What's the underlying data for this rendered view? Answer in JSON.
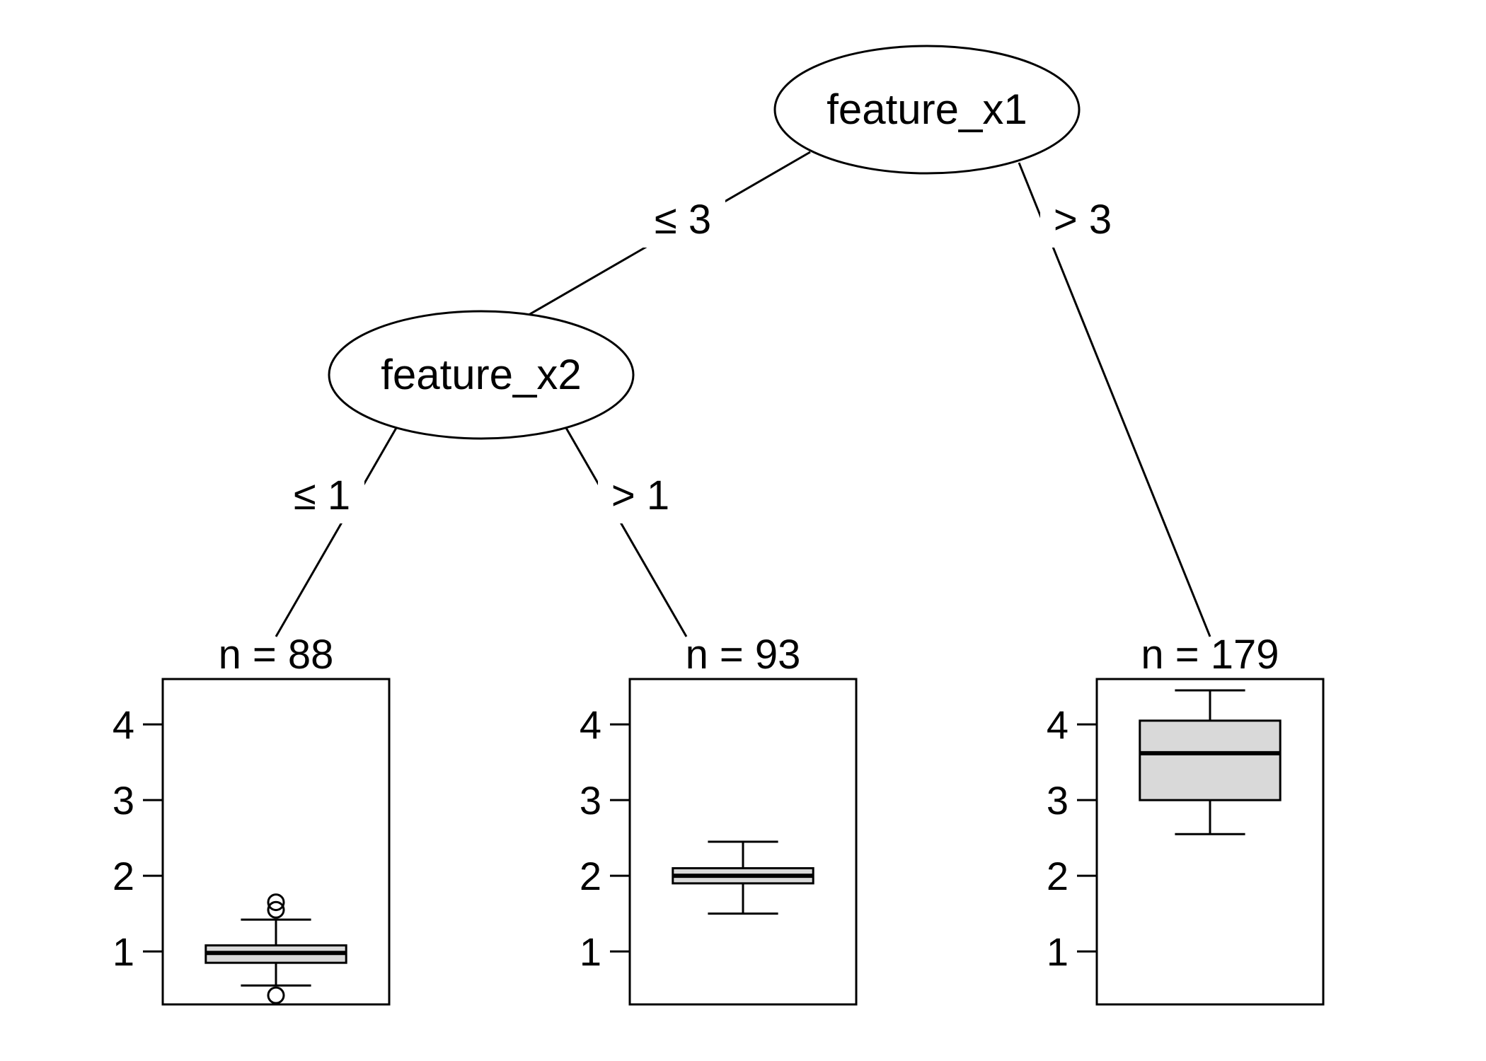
{
  "chart_data": {
    "type": "tree_boxplot",
    "description": "Decision tree with two internal nodes and three terminal boxplot nodes",
    "y_axis_ticks": [
      1,
      2,
      3,
      4
    ],
    "y_range": [
      0.3,
      4.6
    ],
    "nodes": {
      "root": {
        "feature": "feature_x1",
        "split_left": "≤ 3",
        "split_right": "> 3"
      },
      "left_internal": {
        "feature": "feature_x2",
        "split_left": "≤ 1",
        "split_right": "> 1"
      }
    },
    "terminals": [
      {
        "id": "t1",
        "n_label": "n = 88",
        "n": 88,
        "box": {
          "low_whisker": 0.55,
          "q1": 0.85,
          "median": 0.98,
          "q3": 1.08,
          "high_whisker": 1.42
        },
        "outliers": [
          0.42,
          1.55,
          1.65
        ]
      },
      {
        "id": "t2",
        "n_label": "n = 93",
        "n": 93,
        "box": {
          "low_whisker": 1.5,
          "q1": 1.9,
          "median": 2.0,
          "q3": 2.1,
          "high_whisker": 2.45
        },
        "outliers": []
      },
      {
        "id": "t3",
        "n_label": "n = 179",
        "n": 179,
        "box": {
          "low_whisker": 2.55,
          "q1": 3.0,
          "median": 3.62,
          "q3": 4.05,
          "high_whisker": 4.45
        },
        "outliers": []
      }
    ]
  }
}
